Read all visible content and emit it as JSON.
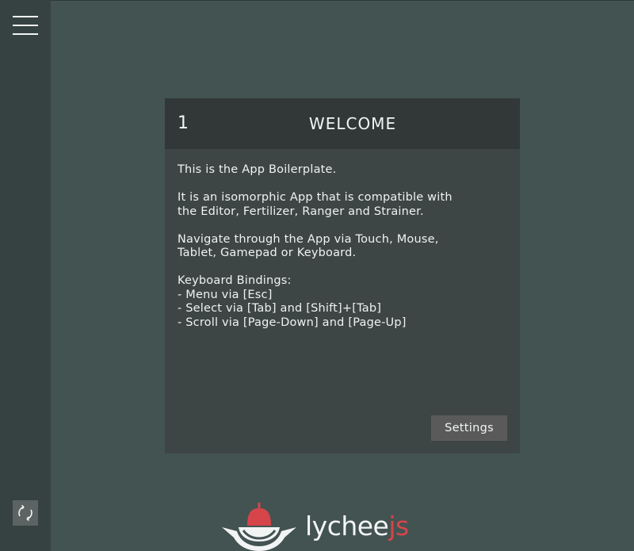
{
  "sidebar": {
    "menu_icon": "hamburger-menu-icon",
    "sync_icon": "sync-icon"
  },
  "dialog": {
    "number": "1",
    "title": "WELCOME",
    "paragraphs": [
      [
        "This is the App Boilerplate."
      ],
      [
        "It is an isomorphic App that is compatible with",
        "the Editor, Fertilizer, Ranger and Strainer."
      ],
      [
        "Navigate through the App via Touch, Mouse,",
        "Tablet, Gamepad or Keyboard."
      ],
      [
        "Keyboard Bindings:",
        "- Menu via [Esc]",
        "- Select via [Tab] and [Shift]+[Tab]",
        "- Scroll via [Page-Down] and [Page-Up]"
      ]
    ],
    "settings_label": "Settings"
  },
  "logo": {
    "text_main": "lychee",
    "text_accent": "js",
    "accent_color": "#d6454a"
  }
}
